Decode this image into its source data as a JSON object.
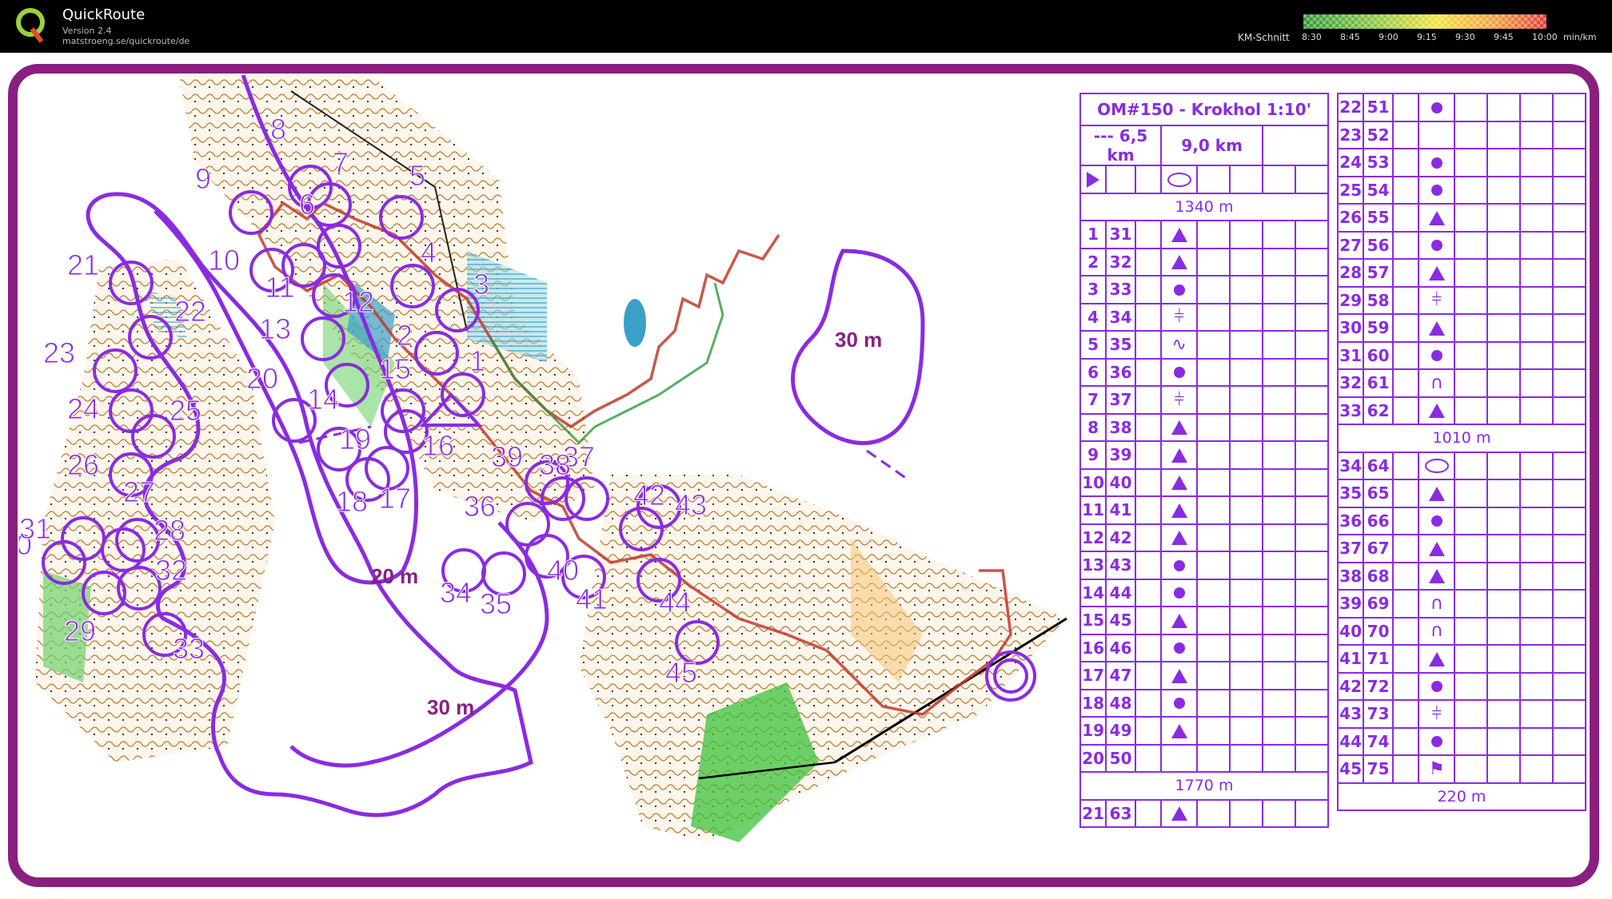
{
  "app": {
    "name": "QuickRoute",
    "version": "Version 2.4",
    "url": "matstroeng.se/quickroute/de"
  },
  "pace_legend": {
    "label": "KM-Schnitt",
    "ticks": [
      "8:30",
      "8:45",
      "9:00",
      "9:15",
      "9:30",
      "9:45",
      "10:00"
    ],
    "unit": "min/km",
    "colors": [
      "#2e9a3a",
      "#8cc63f",
      "#f2e33a",
      "#f39a3a",
      "#e23a3a"
    ]
  },
  "frame_color": "#8a1f7f",
  "course_color": "#8a2be2",
  "route_color": "#c03a2b",
  "map": {
    "labels": [
      "20 m",
      "30 m",
      "30 m"
    ],
    "controls": [
      "1",
      "2",
      "3",
      "4",
      "5",
      "6",
      "7",
      "8",
      "9",
      "10",
      "11",
      "12",
      "13",
      "14",
      "15",
      "16",
      "17",
      "18",
      "19",
      "20",
      "21",
      "22",
      "23",
      "24",
      "25",
      "26",
      "27",
      "28",
      "29",
      "30",
      "31",
      "32",
      "33",
      "34",
      "35",
      "36",
      "37",
      "38",
      "39",
      "40",
      "41",
      "42",
      "43",
      "44",
      "45"
    ]
  },
  "description_sheet": {
    "title": "OM#150 - Krokhol 1:10'",
    "distance_left": "--- 6,5 km",
    "distance_right": "9,0 km",
    "leg1": "1340 m",
    "leg2": "1010 m",
    "leg3": "1770 m",
    "leg4": "220 m",
    "rows_left": [
      {
        "n": "1",
        "code": "31",
        "sym": "tri"
      },
      {
        "n": "2",
        "code": "32",
        "sym": "tri"
      },
      {
        "n": "3",
        "code": "33",
        "sym": "dot"
      },
      {
        "n": "4",
        "code": "34",
        "sym": "comb"
      },
      {
        "n": "5",
        "code": "35",
        "sym": "wave"
      },
      {
        "n": "6",
        "code": "36",
        "sym": "dot"
      },
      {
        "n": "7",
        "code": "37",
        "sym": "comb"
      },
      {
        "n": "8",
        "code": "38",
        "sym": "tri"
      },
      {
        "n": "9",
        "code": "39",
        "sym": "tri"
      },
      {
        "n": "10",
        "code": "40",
        "sym": "tri"
      },
      {
        "n": "11",
        "code": "41",
        "sym": "tri"
      },
      {
        "n": "12",
        "code": "42",
        "sym": "tri"
      },
      {
        "n": "13",
        "code": "43",
        "sym": "dot"
      },
      {
        "n": "14",
        "code": "44",
        "sym": "dot"
      },
      {
        "n": "15",
        "code": "45",
        "sym": "tri"
      },
      {
        "n": "16",
        "code": "46",
        "sym": "dot"
      },
      {
        "n": "17",
        "code": "47",
        "sym": "tri"
      },
      {
        "n": "18",
        "code": "48",
        "sym": "dot"
      },
      {
        "n": "19",
        "code": "49",
        "sym": "tri"
      },
      {
        "n": "20",
        "code": "50",
        "sym": ""
      }
    ],
    "row21": {
      "n": "21",
      "code": "63",
      "sym": "tri"
    },
    "rows_right_a": [
      {
        "n": "22",
        "code": "51",
        "sym": "dot"
      },
      {
        "n": "23",
        "code": "52",
        "sym": ""
      },
      {
        "n": "24",
        "code": "53",
        "sym": "dot"
      },
      {
        "n": "25",
        "code": "54",
        "sym": "dot"
      },
      {
        "n": "26",
        "code": "55",
        "sym": "tri"
      },
      {
        "n": "27",
        "code": "56",
        "sym": "dot"
      },
      {
        "n": "28",
        "code": "57",
        "sym": "tri"
      },
      {
        "n": "29",
        "code": "58",
        "sym": "comb"
      },
      {
        "n": "30",
        "code": "59",
        "sym": "tri"
      },
      {
        "n": "31",
        "code": "60",
        "sym": "dot"
      },
      {
        "n": "32",
        "code": "61",
        "sym": "bump"
      },
      {
        "n": "33",
        "code": "62",
        "sym": "tri"
      }
    ],
    "rows_right_b": [
      {
        "n": "34",
        "code": "64",
        "sym": "ell"
      },
      {
        "n": "35",
        "code": "65",
        "sym": "tri"
      },
      {
        "n": "36",
        "code": "66",
        "sym": "dot"
      },
      {
        "n": "37",
        "code": "67",
        "sym": "tri"
      },
      {
        "n": "38",
        "code": "68",
        "sym": "tri"
      },
      {
        "n": "39",
        "code": "69",
        "sym": "bump"
      },
      {
        "n": "40",
        "code": "70",
        "sym": "bump"
      },
      {
        "n": "41",
        "code": "71",
        "sym": "tri"
      },
      {
        "n": "42",
        "code": "72",
        "sym": "dot"
      },
      {
        "n": "43",
        "code": "73",
        "sym": "comb"
      },
      {
        "n": "44",
        "code": "74",
        "sym": "dot"
      },
      {
        "n": "45",
        "code": "75",
        "sym": "flag"
      }
    ]
  }
}
